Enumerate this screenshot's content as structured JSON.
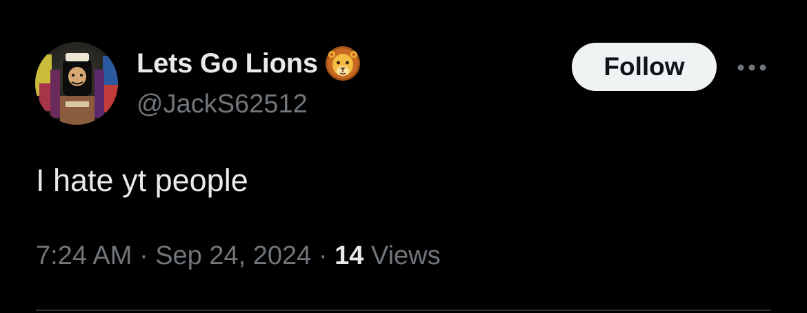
{
  "author": {
    "display_name": "Lets Go Lions",
    "name_badge_icon": "lion-face-icon",
    "handle": "@JackS62512",
    "avatar_icon": "avatar-character-icon"
  },
  "actions": {
    "follow_label": "Follow",
    "more_icon": "more-options-icon"
  },
  "post": {
    "text": "I hate yt people"
  },
  "meta": {
    "time": "7:24 AM",
    "separator": "·",
    "date": "Sep 24, 2024",
    "views_count": "14",
    "views_label": "Views"
  },
  "colors": {
    "background": "#000000",
    "primary_text": "#e7e9ea",
    "secondary_text": "#71767b",
    "follow_bg": "#eff3f4",
    "follow_text": "#0f1419",
    "divider": "#2f3336"
  }
}
